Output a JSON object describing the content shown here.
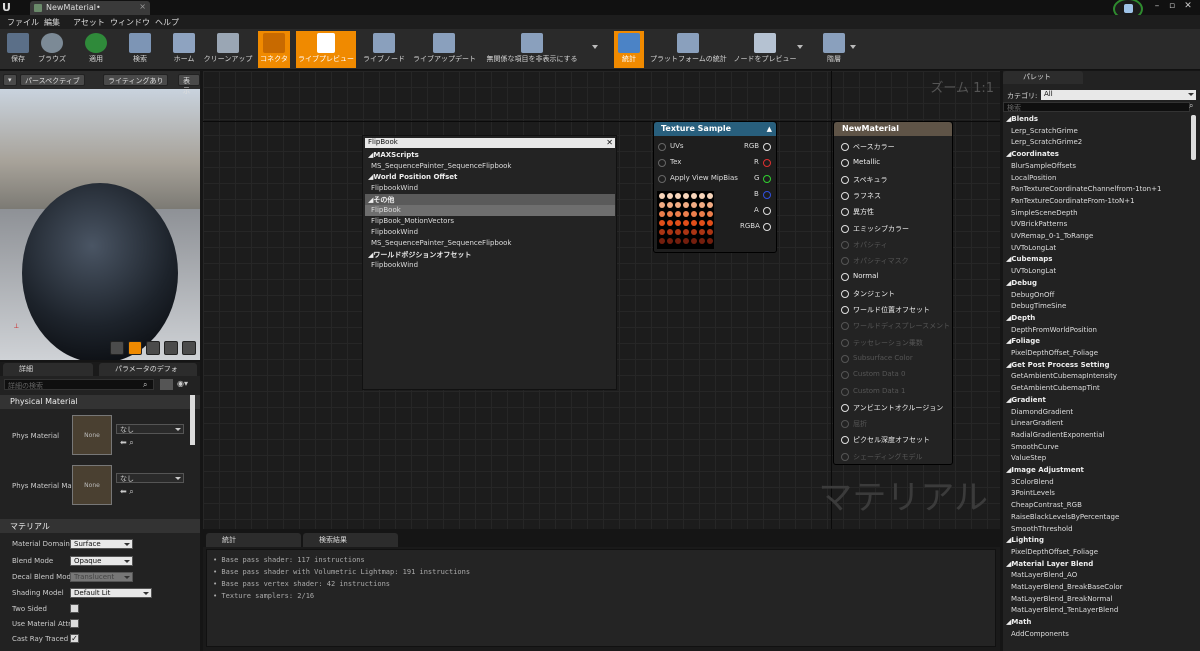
{
  "window": {
    "tab_title": "NewMaterial•"
  },
  "menu": [
    "ファイル",
    "編集",
    "アセット",
    "ウィンドウ",
    "ヘルプ"
  ],
  "toolbar": [
    {
      "label": "保存",
      "icon": "save-icon"
    },
    {
      "label": "ブラウズ",
      "icon": "browse-icon"
    },
    {
      "label": "適用",
      "icon": "apply-icon"
    },
    {
      "label": "検索",
      "icon": "search-icon"
    },
    {
      "label": "ホーム",
      "icon": "home-icon"
    },
    {
      "label": "クリーンアップ",
      "icon": "cleanup-icon"
    },
    {
      "label": "コネクタ",
      "icon": "connector-icon",
      "active": true
    },
    {
      "label": "ライブプレビュー",
      "icon": "live-preview-icon",
      "active": true
    },
    {
      "label": "ライブノード",
      "icon": "live-node-icon"
    },
    {
      "label": "ライブアップデート",
      "icon": "live-update-icon"
    },
    {
      "label": "無関係な項目を非表示にする",
      "icon": "hide-unrelated-icon"
    },
    {
      "label": "統計",
      "icon": "stats-icon",
      "active": true
    },
    {
      "label": "プラットフォームの統計",
      "icon": "platform-stats-icon"
    },
    {
      "label": "ノードをプレビュー",
      "icon": "preview-node-icon"
    },
    {
      "label": "階層",
      "icon": "hierarchy-icon"
    }
  ],
  "viewport": {
    "perspective_btn": "パースペクティブ",
    "lighting_btn": "ライティングあり",
    "show_btn": "表示"
  },
  "details": {
    "tab_details": "詳細",
    "tab_params": "パラメータのデフォ",
    "search_placeholder": "詳細の検索",
    "section_physical": "Physical Material",
    "phys_material_label": "Phys Material",
    "phys_material_mask_label": "Phys Material Ma",
    "thumb_text": "None",
    "none_option": "なし",
    "section_material": "マテリアル",
    "props": [
      {
        "label": "Material Domain",
        "value": "Surface"
      },
      {
        "label": "Blend Mode",
        "value": "Opaque"
      },
      {
        "label": "Decal Blend Mode",
        "value": "Translucent"
      },
      {
        "label": "Shading Model",
        "value": "Default Lit"
      },
      {
        "label": "Two Sided",
        "value": ""
      },
      {
        "label": "Use Material Attri",
        "value": ""
      },
      {
        "label": "Cast Ray Traced",
        "value": ""
      }
    ]
  },
  "graph": {
    "zoom": "ズーム 1:1",
    "watermark": "マテリアル"
  },
  "flipbook_menu": {
    "search_value": "FlipBook",
    "rows": [
      {
        "text": "MAXScripts",
        "cat": true
      },
      {
        "text": "MS_SequencePainter_SequenceFlipbook",
        "cat": false
      },
      {
        "text": "World Position Offset",
        "cat": true
      },
      {
        "text": "FlipbookWind",
        "cat": false
      },
      {
        "text": "その他",
        "cat": true,
        "hl": true
      },
      {
        "text": "FlipBook",
        "cat": false,
        "hl": true
      },
      {
        "text": "FlipBook_MotionVectors",
        "cat": false
      },
      {
        "text": "FlipbookWind",
        "cat": false
      },
      {
        "text": "MS_SequencePainter_SequenceFlipbook",
        "cat": false
      },
      {
        "text": "ワールドポジションオフセット",
        "cat": true
      },
      {
        "text": "FlipbookWind",
        "cat": false
      }
    ]
  },
  "texture_sample": {
    "title": "Texture Sample",
    "inputs": [
      "UVs",
      "Tex",
      "Apply View MipBias"
    ],
    "outputs": [
      "RGB",
      "R",
      "G",
      "B",
      "A",
      "RGBA"
    ],
    "colors": {
      "RGB": "#dddddd",
      "R": "#e03030",
      "G": "#30d030",
      "B": "#3050e0",
      "A": "#dddddd",
      "RGBA": "#dddddd"
    }
  },
  "material_node": {
    "title": "NewMaterial",
    "pins": [
      {
        "label": "ベースカラー",
        "enabled": true
      },
      {
        "label": "Metallic",
        "enabled": true
      },
      {
        "label": "スペキュラ",
        "enabled": true
      },
      {
        "label": "ラフネス",
        "enabled": true
      },
      {
        "label": "異方性",
        "enabled": true
      },
      {
        "label": "エミッシブカラー",
        "enabled": true
      },
      {
        "label": "オパシティ",
        "enabled": false
      },
      {
        "label": "オパシティマスク",
        "enabled": false
      },
      {
        "label": "Normal",
        "enabled": true
      },
      {
        "label": "タンジェント",
        "enabled": true
      },
      {
        "label": "ワールド位置オフセット",
        "enabled": true
      },
      {
        "label": "ワールドディスプレースメント",
        "enabled": false
      },
      {
        "label": "テッセレーション乗数",
        "enabled": false
      },
      {
        "label": "Subsurface Color",
        "enabled": false
      },
      {
        "label": "Custom Data 0",
        "enabled": false
      },
      {
        "label": "Custom Data 1",
        "enabled": false
      },
      {
        "label": "アンビエントオクルージョン",
        "enabled": true
      },
      {
        "label": "屈折",
        "enabled": false
      },
      {
        "label": "ピクセル深度オフセット",
        "enabled": true
      },
      {
        "label": "シェーディングモデル",
        "enabled": false
      }
    ]
  },
  "stats": {
    "tab_stats": "統計",
    "tab_search": "検索結果",
    "lines": [
      "• Base pass shader: 117 instructions",
      "• Base pass shader with Volumetric Lightmap: 191 instructions",
      "• Base pass vertex shader: 42 instructions",
      "• Texture samplers: 2/16"
    ]
  },
  "palette": {
    "tab": "パレット",
    "category_label": "カテゴリ:",
    "category_value": "All",
    "search_placeholder": "検索",
    "items": [
      {
        "t": "Blends",
        "c": true
      },
      {
        "t": "Lerp_ScratchGrime"
      },
      {
        "t": "Lerp_ScratchGrime2"
      },
      {
        "t": "Coordinates",
        "c": true
      },
      {
        "t": "BlurSampleOffsets"
      },
      {
        "t": "LocalPosition"
      },
      {
        "t": "PanTextureCoordinateChannelfrom-1ton+1"
      },
      {
        "t": "PanTextureCoordinateFrom-1toN+1"
      },
      {
        "t": "SimpleSceneDepth"
      },
      {
        "t": "UVBrickPatterns"
      },
      {
        "t": "UVRemap_0-1_ToRange"
      },
      {
        "t": "UVToLongLat"
      },
      {
        "t": "Cubemaps",
        "c": true
      },
      {
        "t": "UVToLongLat"
      },
      {
        "t": "Debug",
        "c": true
      },
      {
        "t": "DebugOnOff"
      },
      {
        "t": "DebugTimeSine"
      },
      {
        "t": "Depth",
        "c": true
      },
      {
        "t": "DepthFromWorldPosition"
      },
      {
        "t": "Foliage",
        "c": true
      },
      {
        "t": "PixelDepthOffset_Foliage"
      },
      {
        "t": "Get Post Process Setting",
        "c": true
      },
      {
        "t": "GetAmbientCubemapIntensity"
      },
      {
        "t": "GetAmbientCubemapTint"
      },
      {
        "t": "Gradient",
        "c": true
      },
      {
        "t": "DiamondGradient"
      },
      {
        "t": "LinearGradient"
      },
      {
        "t": "RadialGradientExponential"
      },
      {
        "t": "SmoothCurve"
      },
      {
        "t": "ValueStep"
      },
      {
        "t": "Image Adjustment",
        "c": true
      },
      {
        "t": "3ColorBlend"
      },
      {
        "t": "3PointLevels"
      },
      {
        "t": "CheapContrast_RGB"
      },
      {
        "t": "RaiseBlackLevelsByPercentage"
      },
      {
        "t": "SmoothThreshold"
      },
      {
        "t": "Lighting",
        "c": true
      },
      {
        "t": "PixelDepthOffset_Foliage"
      },
      {
        "t": "Material Layer Blend",
        "c": true
      },
      {
        "t": "MatLayerBlend_AO"
      },
      {
        "t": "MatLayerBlend_BreakBaseColor"
      },
      {
        "t": "MatLayerBlend_BreakNormal"
      },
      {
        "t": "MatLayerBlend_TenLayerBlend"
      },
      {
        "t": "Math",
        "c": true
      },
      {
        "t": "AddComponents"
      }
    ]
  }
}
